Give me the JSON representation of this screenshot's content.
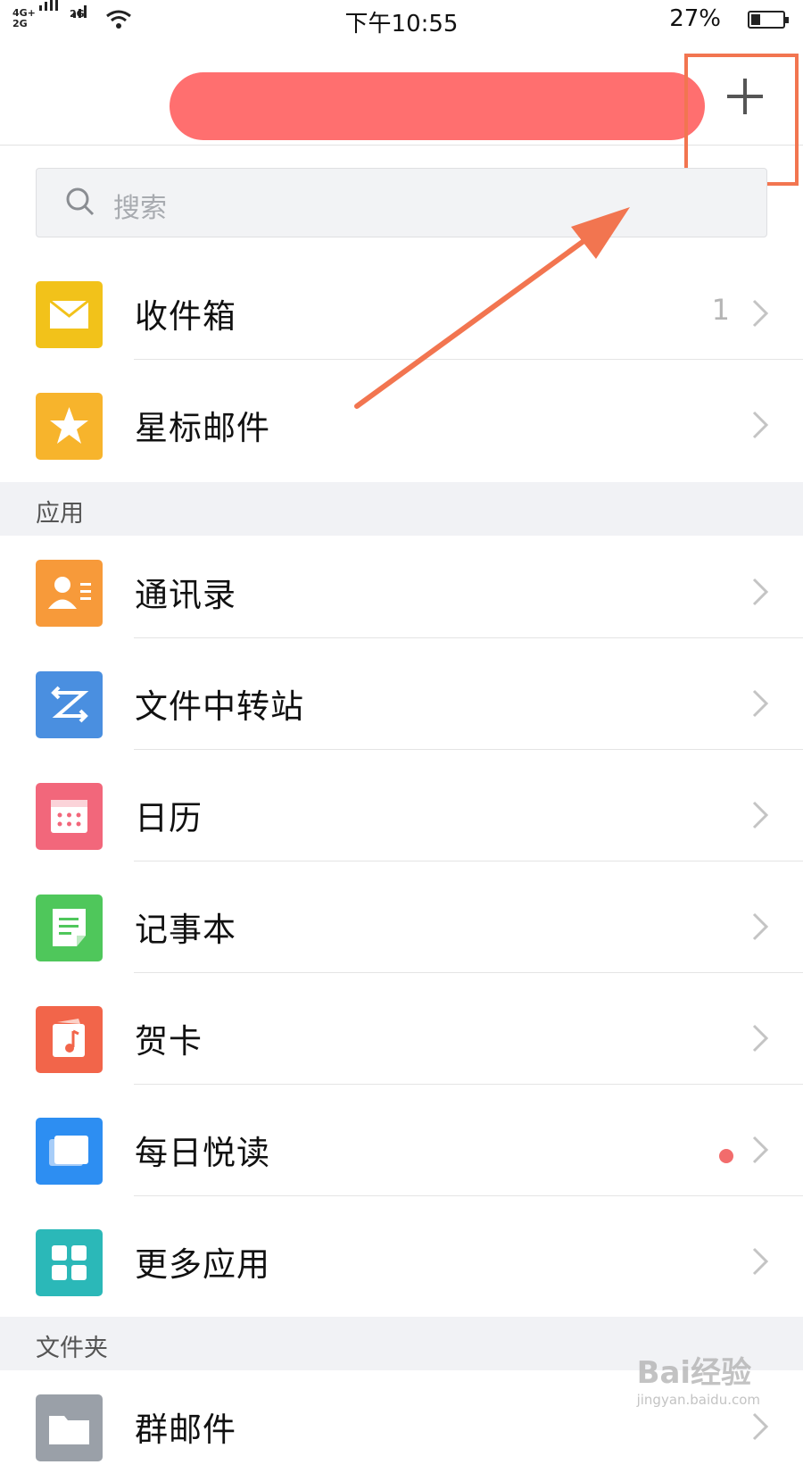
{
  "status_bar": {
    "network_left_top": "4G+",
    "network_left_bottom": "2G",
    "network_right": "2G",
    "time": "下午10:55",
    "battery": "27%"
  },
  "header": {
    "add_icon": "plus-icon"
  },
  "search": {
    "placeholder": "搜索"
  },
  "mail_items": [
    {
      "label": "收件箱",
      "count": "1",
      "icon": "envelope-icon",
      "color": "#f2c21a"
    },
    {
      "label": "星标邮件",
      "icon": "star-icon",
      "color": "#f7b42c"
    }
  ],
  "apps_section": {
    "title": "应用",
    "items": [
      {
        "label": "通讯录",
        "icon": "contact-card-icon",
        "color": "#f79a3a"
      },
      {
        "label": "文件中转站",
        "icon": "transfer-icon",
        "color": "#4a8fe0"
      },
      {
        "label": "日历",
        "icon": "calendar-icon",
        "color": "#f2677b"
      },
      {
        "label": "记事本",
        "icon": "note-icon",
        "color": "#4fc75b"
      },
      {
        "label": "贺卡",
        "icon": "music-card-icon",
        "color": "#f2654a"
      },
      {
        "label": "每日悦读",
        "icon": "reader-icon",
        "color": "#2d8ef2",
        "badge": "red-dot"
      },
      {
        "label": "更多应用",
        "icon": "grid-icon",
        "color": "#2bb8b8"
      }
    ]
  },
  "folders_section": {
    "title": "文件夹",
    "items": [
      {
        "label": "群邮件",
        "icon": "folder-icon",
        "color": "#9aa0a8"
      }
    ]
  },
  "watermark": {
    "brand": "Bai经验",
    "url": "jingyan.baidu.com"
  },
  "annotation_color": "#f27550"
}
